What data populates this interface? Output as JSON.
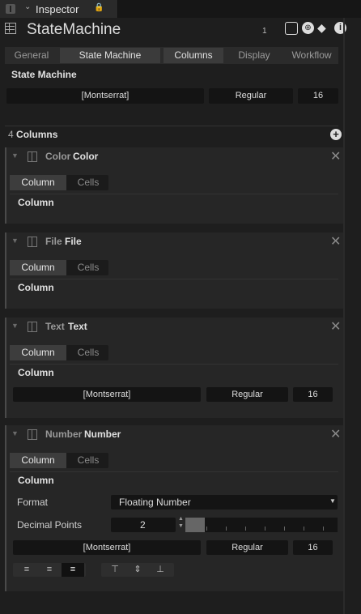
{
  "window": {
    "tab_title": "Inspector",
    "object_name": "StateMachine",
    "count": "1"
  },
  "tabs": [
    {
      "label": "General",
      "active": false
    },
    {
      "label": "State Machine",
      "active": true
    },
    {
      "label": "Columns",
      "active": true
    },
    {
      "label": "Display",
      "active": false
    },
    {
      "label": "Workflow",
      "active": false
    }
  ],
  "state_machine": {
    "title": "State Machine",
    "font": "[Montserrat]",
    "weight": "Regular",
    "size": "16"
  },
  "columns_header": {
    "count": "4",
    "label": "Columns"
  },
  "columns": [
    {
      "type": "Color",
      "name": "Color",
      "tab_column": "Column",
      "tab_cells": "Cells",
      "section": "Column"
    },
    {
      "type": "File",
      "name": "File",
      "tab_column": "Column",
      "tab_cells": "Cells",
      "section": "Column"
    },
    {
      "type": "Text",
      "name": "Text",
      "tab_column": "Column",
      "tab_cells": "Cells",
      "section": "Column",
      "font": "[Montserrat]",
      "weight": "Regular",
      "size": "16"
    },
    {
      "type": "Number",
      "name": "Number",
      "tab_column": "Column",
      "tab_cells": "Cells",
      "section": "Column",
      "format_label": "Format",
      "format_value": "Floating Number",
      "decimal_label": "Decimal Points",
      "decimal_value": "2",
      "font": "[Montserrat]",
      "weight": "Regular",
      "size": "16"
    }
  ],
  "icons": {
    "menu": "sidebar-menu-icon",
    "chevron": "chevron-down-icon",
    "lock": "lock-icon",
    "table": "table-icon",
    "checkbox": "checkbox-icon",
    "globe": "globe-icon",
    "tag": "tag-icon",
    "info": "info-icon",
    "add": "add-circle-icon",
    "collapse": "triangle-collapse-icon",
    "column": "column-icon",
    "close": "close-icon"
  },
  "colors": {
    "background": "#1e1e1e",
    "panel": "#262626",
    "field": "#141414",
    "tab_active": "#3b3b3b"
  }
}
